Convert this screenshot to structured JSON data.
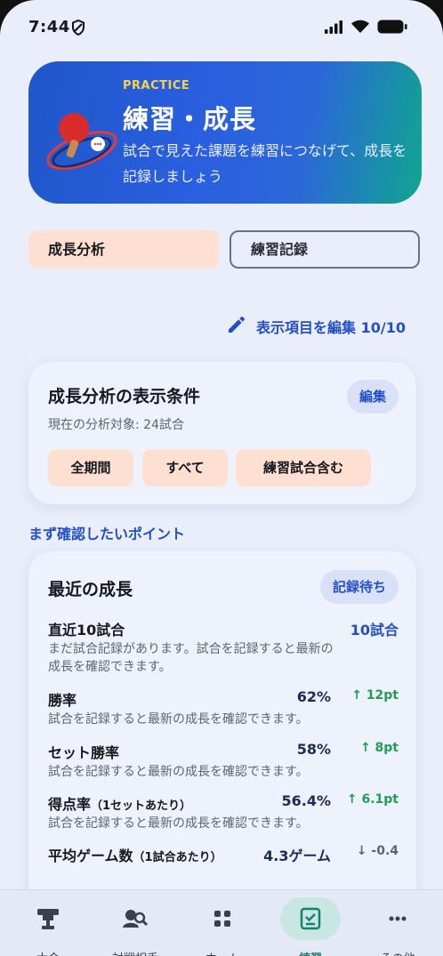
{
  "status_bar": {
    "time": "7:44"
  },
  "hero": {
    "eyebrow": "PRACTICE",
    "title": "練習・成長",
    "subtitle": "試合で見えた課題を練習につなげて、成長を記録しましょう"
  },
  "tabs": [
    {
      "label": "成長分析",
      "active": true
    },
    {
      "label": "練習記録",
      "active": false
    }
  ],
  "edit_link": {
    "label": "表示項目を編集 10/10"
  },
  "conditions_card": {
    "title": "成長分析の表示条件",
    "edit_label": "編集",
    "target_text": "現在の分析対象: 24試合",
    "chips": [
      "全期間",
      "すべて",
      "練習試合含む"
    ]
  },
  "section_label": "まず確認したいポイント",
  "growth_card": {
    "title": "最近の成長",
    "badge": "記録待ち",
    "recent": {
      "label": "直近10試合",
      "value": "10試合",
      "desc_line1": "まだ試合記録があります。試合を記録すると最新の",
      "desc_line2": "成長を確認できます。"
    },
    "metrics": [
      {
        "label": "勝率",
        "qualifier": "",
        "value": "62%",
        "delta": "↑ 12pt",
        "trend": "up",
        "desc": "試合を記録すると最新の成長を確認できます。"
      },
      {
        "label": "セット勝率",
        "qualifier": "",
        "value": "58%",
        "delta": "↑ 8pt",
        "trend": "up",
        "desc": "試合を記録すると最新の成長を確認できます。"
      },
      {
        "label": "得点率",
        "qualifier": "（1セットあたり）",
        "value": "56.4%",
        "delta": "↑ 6.1pt",
        "trend": "up",
        "desc": "試合を記録すると最新の成長を確認できます。"
      },
      {
        "label": "平均ゲーム数",
        "qualifier": "（1試合あたり）",
        "value": "4.3ゲーム",
        "delta": "↓ -0.4",
        "trend": "down",
        "desc": ""
      }
    ]
  },
  "bottom_nav": [
    {
      "label": "大会",
      "icon": "trophy-icon"
    },
    {
      "label": "対戦相手",
      "icon": "opponent-search-icon"
    },
    {
      "label": "ホーム",
      "icon": "grid-icon"
    },
    {
      "label": "練習",
      "icon": "practice-checklist-icon",
      "active": true
    },
    {
      "label": "その他",
      "icon": "more-dots-icon"
    }
  ],
  "colors": {
    "accent": "#2350c8",
    "chip": "#fde0d2",
    "positive": "#1f9d53",
    "nav_active": "#18806f"
  }
}
